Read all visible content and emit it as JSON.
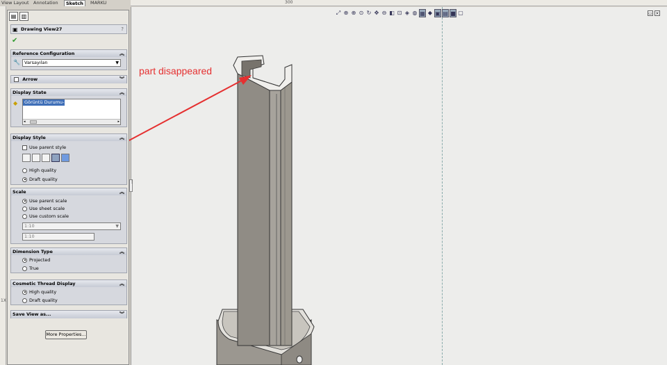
{
  "tabs": [
    {
      "label": "View Layout"
    },
    {
      "label": "Annotation"
    },
    {
      "label": "Sketch"
    },
    {
      "label": "MARKU"
    }
  ],
  "ruler": {
    "h_value": "300",
    "v_value": "1X"
  },
  "panel": {
    "title": "Drawing View27",
    "help": "?",
    "reference_configuration": {
      "label": "Reference Configuration",
      "value": "Varsayılan"
    },
    "arrow": {
      "label": "Arrow"
    },
    "display_state": {
      "label": "Display State",
      "item": "Görüntü Durumu-1"
    },
    "display_style": {
      "label": "Display Style",
      "use_parent": "Use parent style",
      "high_quality": "High quality",
      "draft_quality": "Draft quality"
    },
    "scale": {
      "label": "Scale",
      "use_parent": "Use parent scale",
      "use_sheet": "Use sheet scale",
      "use_custom": "Use custom scale",
      "custom_value": "1:10",
      "custom_text": "1:10"
    },
    "dimension_type": {
      "label": "Dimension Type",
      "projected": "Projected",
      "true": "True"
    },
    "cosmetic_thread": {
      "label": "Cosmetic Thread Display",
      "high_quality": "High quality",
      "draft_quality": "Draft quality"
    },
    "save_view": {
      "label": "Save View as..."
    },
    "more_properties": "More Properties..."
  },
  "annotation": {
    "text": "part disappeared",
    "color": "#e53030"
  },
  "colors": {
    "accent": "#e53030",
    "selection": "#3f6fb8"
  }
}
